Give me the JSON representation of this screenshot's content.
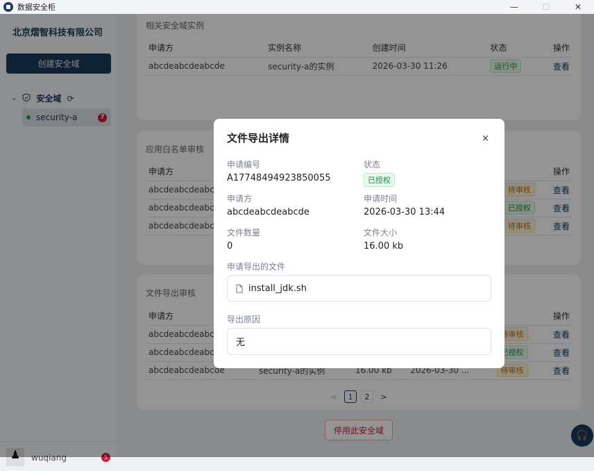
{
  "window": {
    "title": "数据安全柜",
    "minimize": "—",
    "maximize": "☐",
    "close": "✕"
  },
  "sidebar": {
    "company": "北京熠智科技有限公司",
    "create_button": "创建安全域",
    "tree_root": "安全域",
    "items": [
      {
        "label": "security-a",
        "badge": "7",
        "status_color": "#22a34a"
      }
    ],
    "user": {
      "name": "wuqiang",
      "badge": "5"
    }
  },
  "instances": {
    "title": "相关安全域实例",
    "columns": [
      "申请方",
      "实例名称",
      "创建时间",
      "状态",
      "操作"
    ],
    "rows": [
      {
        "applicant": "abcdeabcdeabcde",
        "name": "security-a的实例",
        "time": "2026-03-30 11:26",
        "status": "运行中",
        "action": "查看"
      }
    ]
  },
  "whitelist": {
    "title": "应用白名单审核",
    "columns": [
      "申请方",
      "操作"
    ],
    "rows": [
      {
        "applicant": "abcdeabcdeabcde",
        "status": "待审核",
        "action": "查看"
      },
      {
        "applicant": "abcdeabcdeabcde",
        "status": "已授权",
        "action": "查看"
      },
      {
        "applicant": "abcdeabcdeabcde",
        "status": "待审核",
        "action": "查看"
      }
    ]
  },
  "exports": {
    "title": "文件导出审核",
    "columns": [
      "申请方",
      "操作"
    ],
    "rows": [
      {
        "applicant": "abcdeabcdeabcde",
        "status": "待审核",
        "action": "查看"
      },
      {
        "applicant": "abcdeabcdeabcde",
        "status": "已授权",
        "action": "查看"
      },
      {
        "applicant": "abcdeabcdeabcde",
        "instance": "security-a的实例",
        "size": "16.00 kb",
        "time": "2026-03-30 ...",
        "status": "待审核",
        "action": "查看"
      }
    ],
    "pager": {
      "prev": "<",
      "pages": [
        "1",
        "2"
      ],
      "current": "1",
      "next": ">"
    }
  },
  "disable_button": "停用此安全域",
  "modal": {
    "title": "文件导出详情",
    "close": "×",
    "fields": {
      "id_label": "申请编号",
      "id": "A17748494923850055",
      "status_label": "状态",
      "status": "已授权",
      "applicant_label": "申请方",
      "applicant": "abcdeabcdeabcde",
      "time_label": "申请时间",
      "time": "2026-03-30 13:44",
      "count_label": "文件数量",
      "count": "0",
      "size_label": "文件大小",
      "size": "16.00 kb"
    },
    "files_label": "申请导出的文件",
    "files": [
      "install_jdk.sh"
    ],
    "reason_label": "导出原因",
    "reason": "无"
  }
}
